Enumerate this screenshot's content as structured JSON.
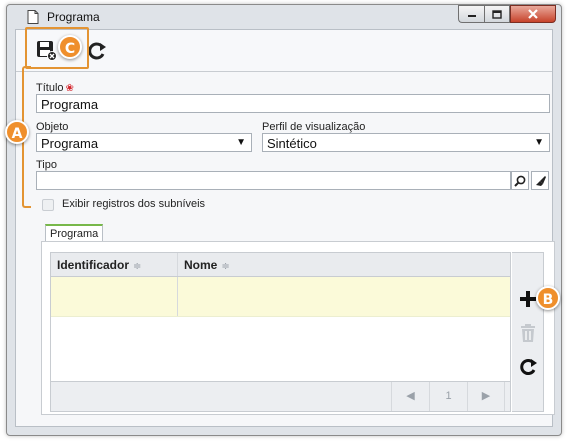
{
  "window": {
    "title": "Programa",
    "controls": {
      "minimize_icon": "minimize-icon",
      "maximize_icon": "maximize-icon",
      "close_icon": "close-icon"
    }
  },
  "toolbar": {
    "save_icon": "save-and-close-icon",
    "refresh_icon": "refresh-icon"
  },
  "form": {
    "titulo": {
      "label": "Título",
      "value": "Programa",
      "required": true
    },
    "objeto": {
      "label": "Objeto",
      "value": "Programa"
    },
    "perfil": {
      "label": "Perfil de visualização",
      "value": "Sintético"
    },
    "tipo": {
      "label": "Tipo",
      "value": ""
    },
    "exibir_subniveis": {
      "label": "Exibir registros dos subníveis",
      "checked": false
    }
  },
  "tabs": [
    {
      "label": "Programa",
      "active": true
    }
  ],
  "grid": {
    "columns": [
      {
        "label": "Identificador"
      },
      {
        "label": "Nome"
      }
    ],
    "rows": [
      {
        "identificador": "",
        "nome": ""
      }
    ],
    "pager": {
      "page": "1"
    }
  },
  "side_tools": {
    "add_icon": "add-icon",
    "delete_icon": "trash-icon",
    "refresh_icon": "refresh-icon"
  },
  "callouts": {
    "a": "A",
    "b": "B",
    "c": "C"
  },
  "colors": {
    "accent": "#ef8f2c",
    "required": "#d4232b",
    "row_highlight": "#fbfad9",
    "tab_active": "#78b84a"
  }
}
